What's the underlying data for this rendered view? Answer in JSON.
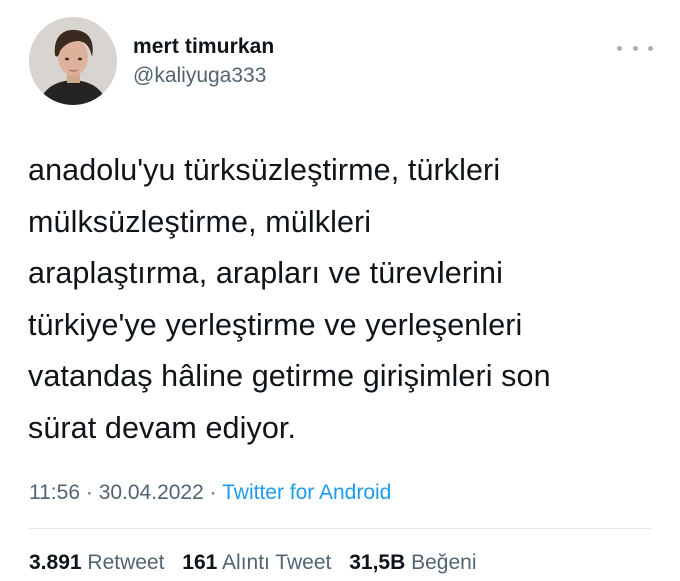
{
  "user": {
    "display_name": "mert timurkan",
    "handle": "@kaliyuga333"
  },
  "tweet": {
    "text": "anadolu'yu türksüzleştirme, türkleri\nmülksüzleştirme, mülkleri\naraplaştırma, arapları ve türevlerini\ntürkiye'ye yerleştirme ve yerleşenleri\nvatandaş hâline getirme girişimleri son\nsürat devam ediyor.",
    "time": "11:56",
    "separator": "·",
    "date": "30.04.2022",
    "source": "Twitter for Android"
  },
  "stats": {
    "retweets_count": "3.891",
    "retweets_label": "Retweet",
    "quotes_count": "161",
    "quotes_label": "Alıntı Tweet",
    "likes_count": "31,5B",
    "likes_label": "Beğeni"
  },
  "icons": {
    "more": "more-horizontal-icon"
  },
  "colors": {
    "primary_text": "#0f1419",
    "secondary_text": "#536471",
    "link": "#1d9bf0",
    "divider": "#e3e7ea"
  }
}
